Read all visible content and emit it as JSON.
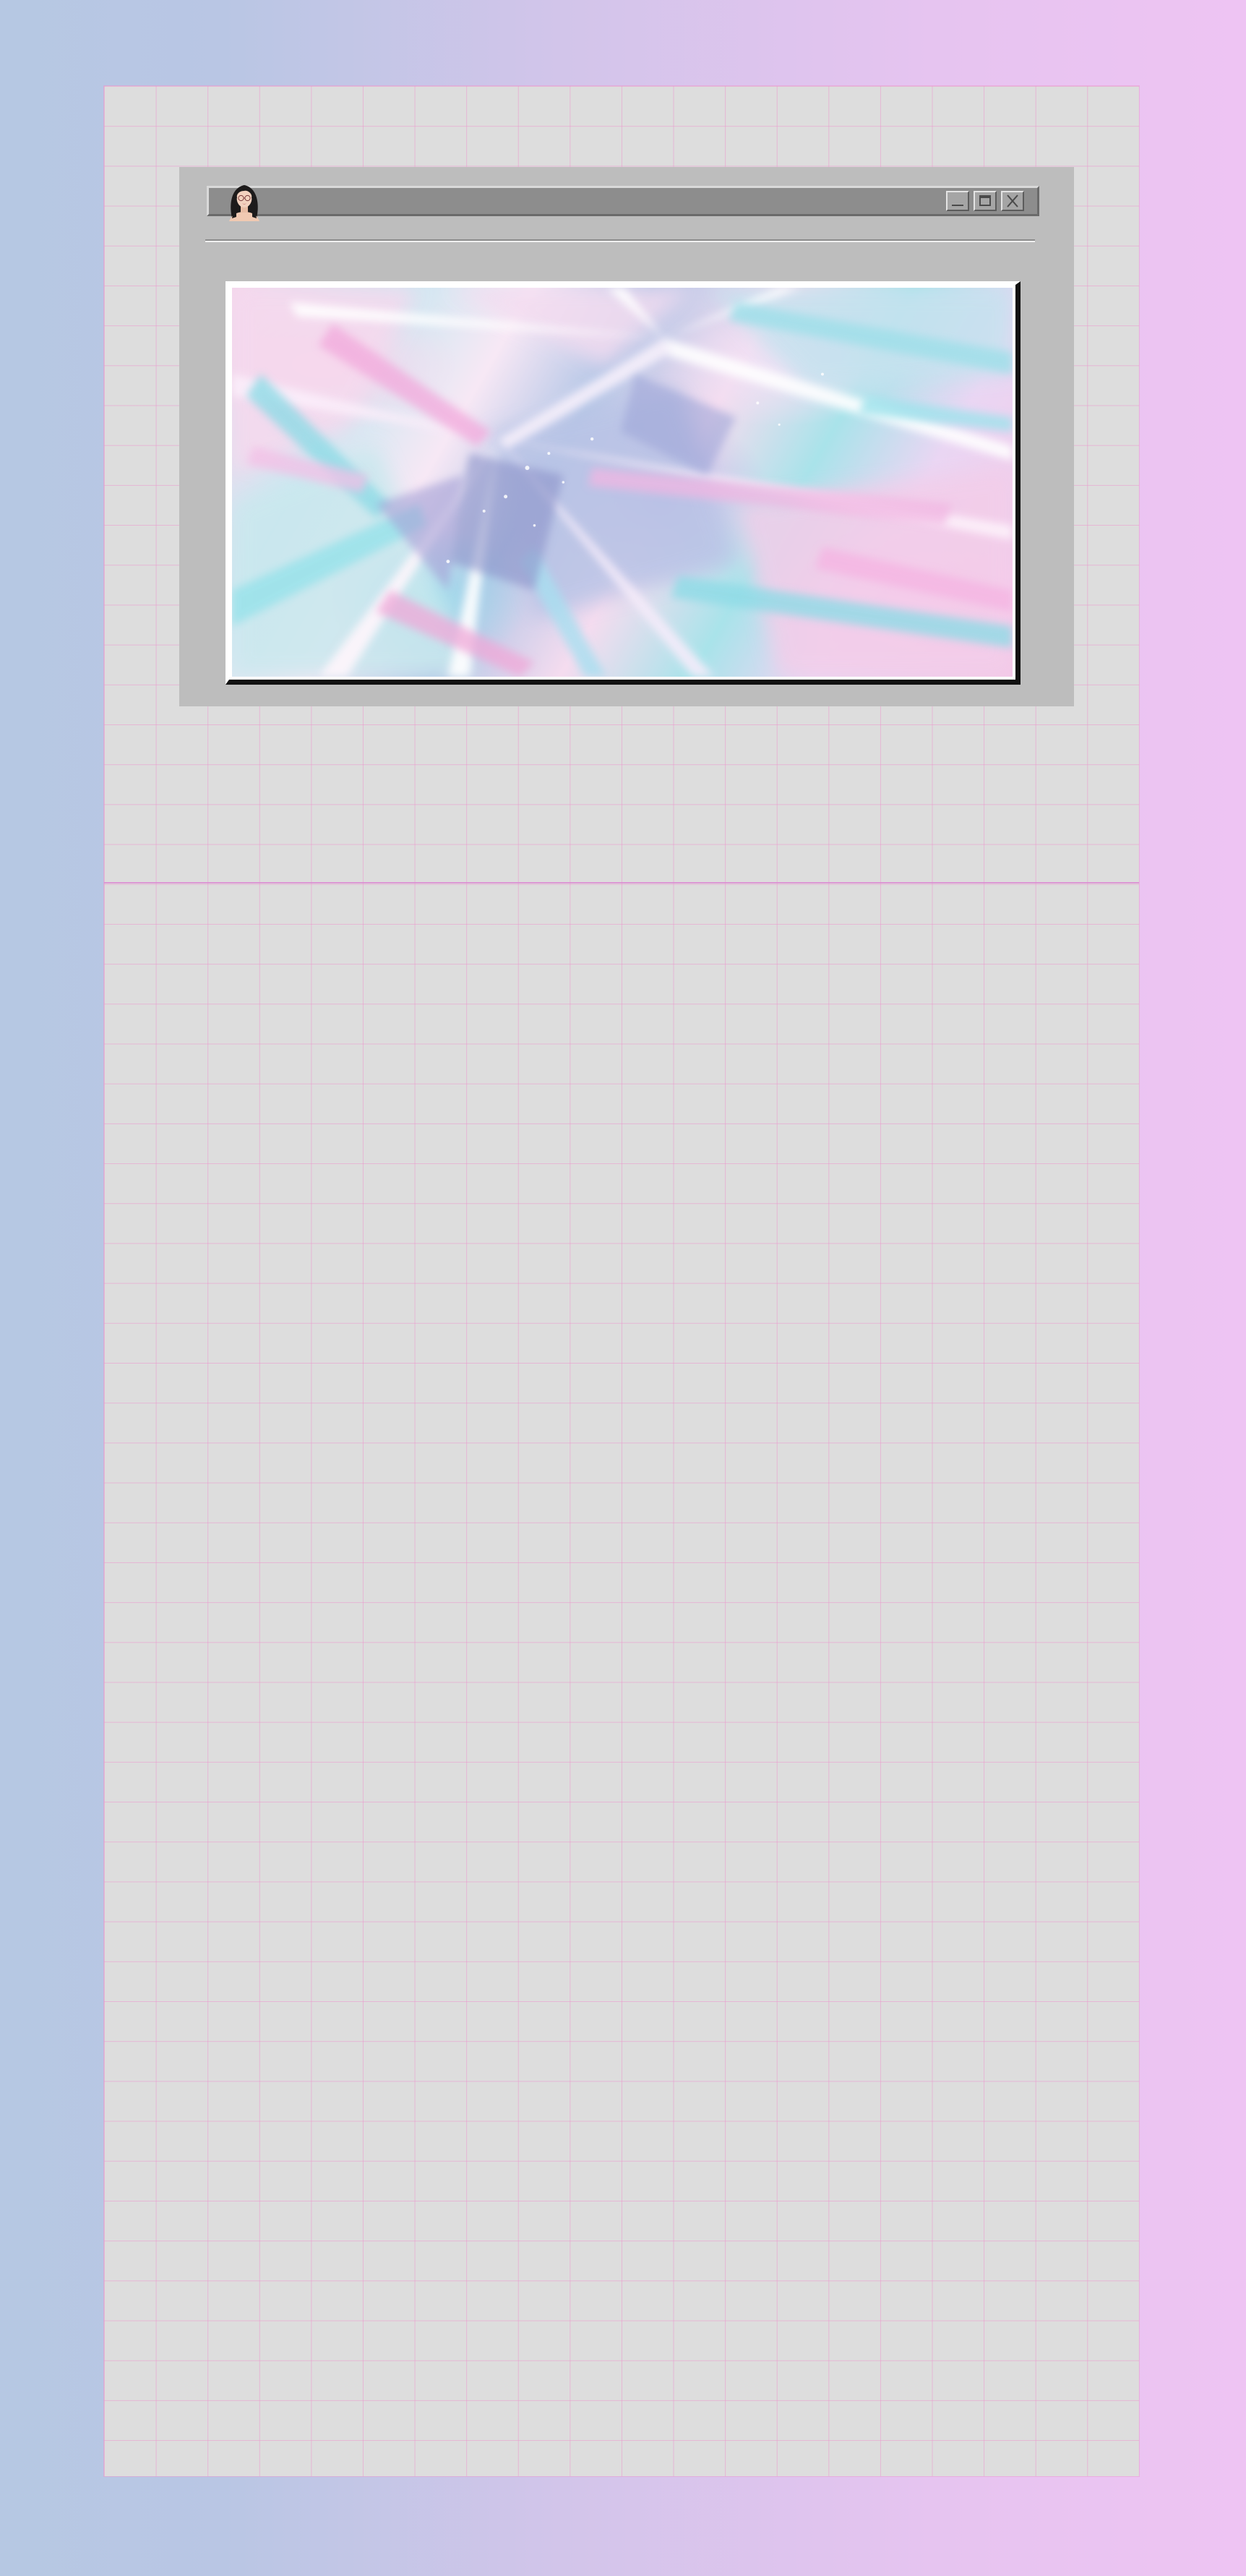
{
  "window": {
    "controls": [
      {
        "name": "minimize",
        "icon": "minimize-icon"
      },
      {
        "name": "maximize",
        "icon": "maximize-icon"
      },
      {
        "name": "close",
        "icon": "close-icon"
      }
    ]
  },
  "colors": {
    "background_left": "#b6c8e3",
    "background_right": "#eec4f3",
    "paper": "#dddddd",
    "grid_line": "#ec96cd",
    "window_body": "#bdbdbd",
    "titlebar": "#8d8d8d"
  }
}
